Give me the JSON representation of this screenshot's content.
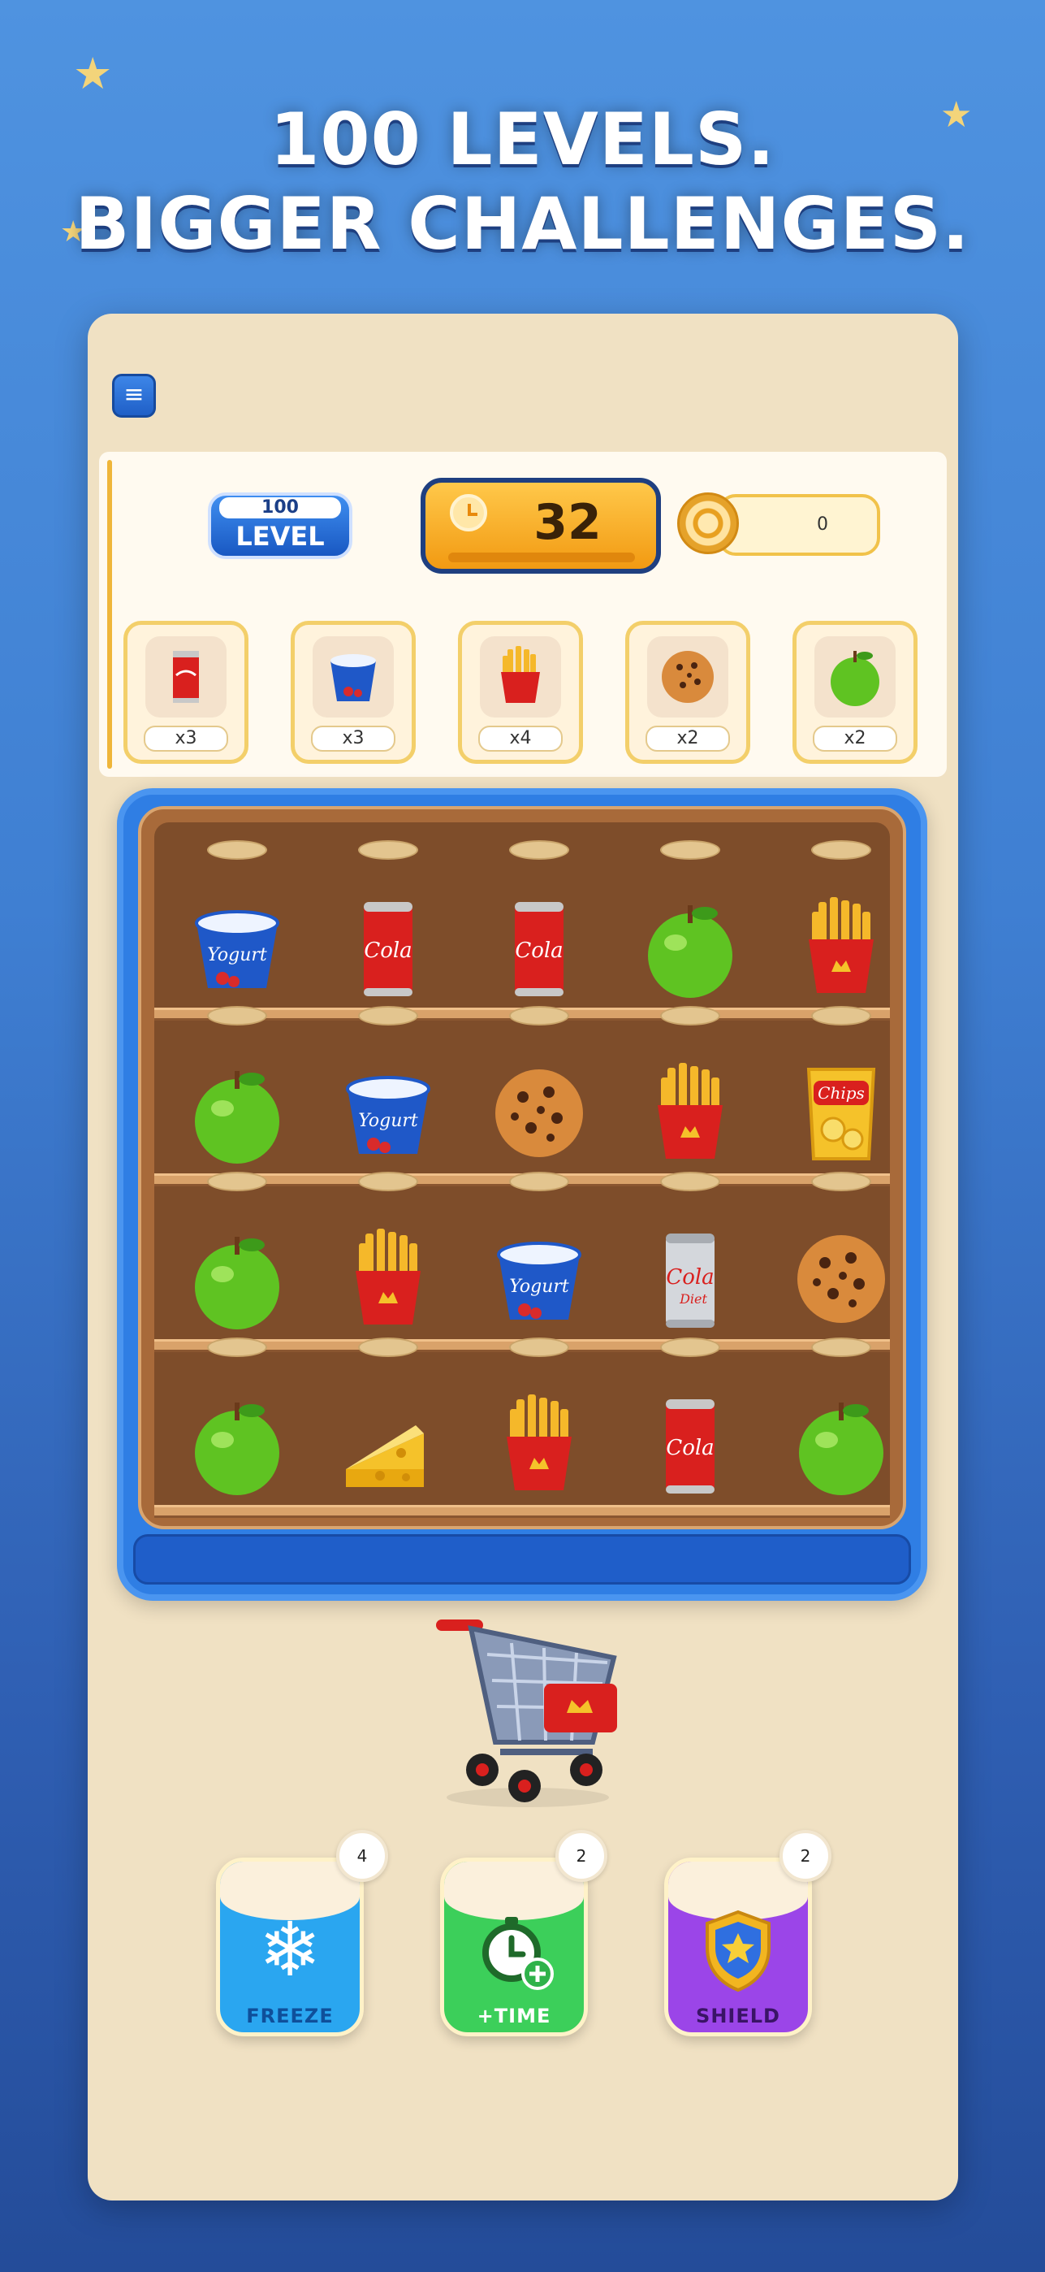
{
  "headline": {
    "line1": "100 LEVELS.",
    "line2": "BIGGER CHALLENGES."
  },
  "hud": {
    "menu_icon": "hamburger-icon",
    "level_number": "100",
    "level_label": "LEVEL",
    "timer_value": "32",
    "coins": "0"
  },
  "goals": [
    {
      "item": "cola-can",
      "count": "x3"
    },
    {
      "item": "yogurt",
      "count": "x3"
    },
    {
      "item": "fries",
      "count": "x4"
    },
    {
      "item": "cookie",
      "count": "x2"
    },
    {
      "item": "green-apple",
      "count": "x2"
    }
  ],
  "shelf": {
    "rows": [
      [
        "yogurt",
        "cola-can",
        "cola-can",
        "green-apple",
        "fries"
      ],
      [
        "green-apple",
        "yogurt",
        "cookie",
        "fries",
        "chips"
      ],
      [
        "green-apple",
        "fries",
        "yogurt",
        "diet-cola-can",
        "cookie"
      ],
      [
        "green-apple",
        "cheese",
        "fries",
        "cola-can",
        "green-apple"
      ]
    ],
    "labels": {
      "yogurt": "Yogurt",
      "cola": "Cola",
      "diet": "Diet",
      "chips": "Chips"
    }
  },
  "boosters": [
    {
      "label": "FREEZE",
      "count": "4",
      "icon": "snowflake-icon",
      "color": "#2aa6f0"
    },
    {
      "label": "+TIME",
      "count": "2",
      "icon": "stopwatch-plus-icon",
      "color": "#3ccf5a"
    },
    {
      "label": "SHIELD",
      "count": "2",
      "icon": "shield-star-icon",
      "color": "#9b45e8"
    }
  ]
}
